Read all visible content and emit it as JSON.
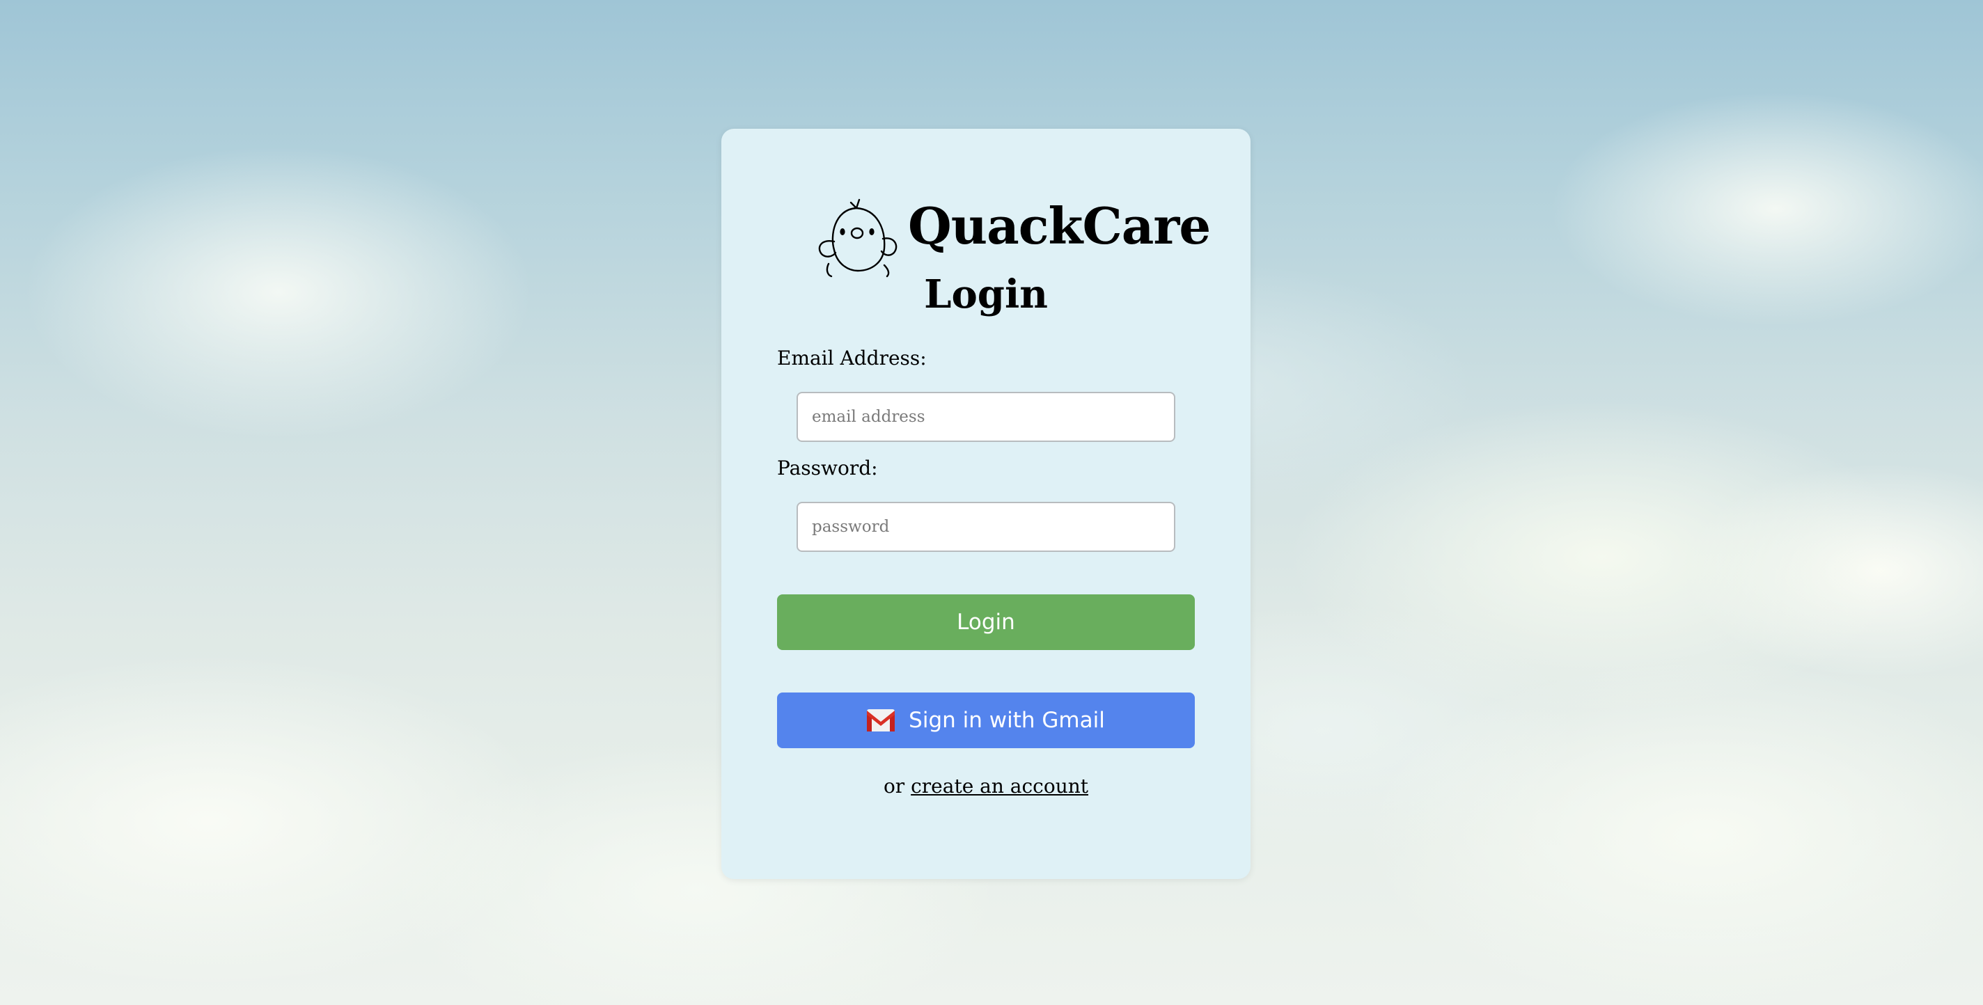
{
  "brand": {
    "name": "QuackCare",
    "logo_icon": "duck-icon"
  },
  "login": {
    "title": "Login",
    "email_label": "Email Address:",
    "email_placeholder": "email address",
    "email_value": "",
    "password_label": "Password:",
    "password_placeholder": "password",
    "password_value": "",
    "login_button": "Login",
    "gmail_button": "Sign in with Gmail",
    "gmail_icon": "gmail-icon",
    "signup_prefix": "or",
    "signup_link": "create an account"
  },
  "colors": {
    "card_background": "#dff1f6",
    "login_button": "#69ae5d",
    "gmail_button": "#5484ed"
  }
}
